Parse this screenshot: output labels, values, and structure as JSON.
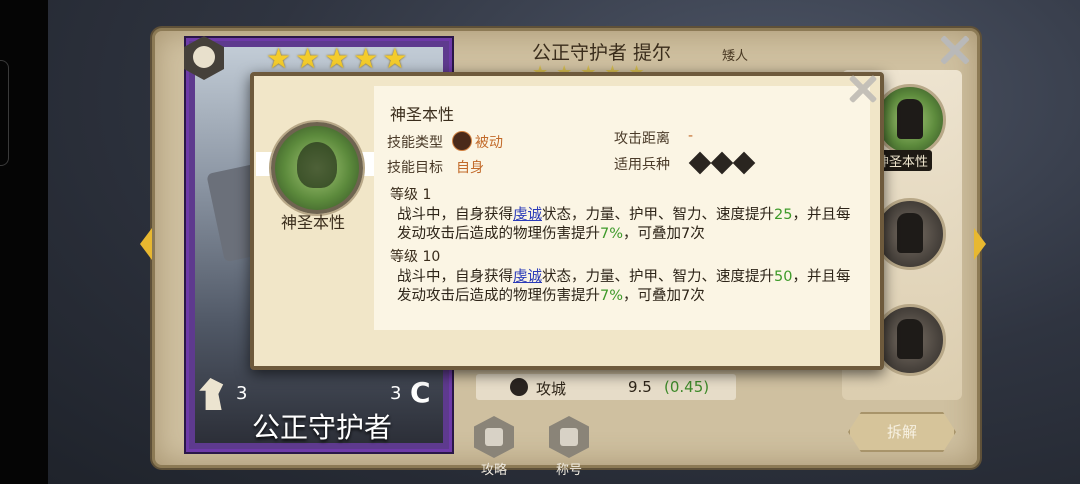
{
  "hero": {
    "title": "公正守护者 提尔",
    "race": "矮人",
    "card_name": "公正守护者",
    "star_count": 5,
    "left_count": "3",
    "right_count": "3"
  },
  "stats": [
    {
      "label": "攻城",
      "value": "9.5",
      "bonus": "(0.45)"
    }
  ],
  "side": {
    "active_skill_label": "神圣本性",
    "disassemble_label": "拆解"
  },
  "bottom": {
    "guide_label": "攻略",
    "title_label": "称号"
  },
  "skill_popup": {
    "emblem_name": "神圣本性",
    "name": "神圣本性",
    "type_label": "技能类型",
    "type_value": "被动",
    "range_label": "攻击距离",
    "range_value": "-",
    "target_label": "技能目标",
    "target_value": "自身",
    "troop_label": "适用兵种",
    "levels": [
      {
        "label": "等级 1",
        "d1": "战斗中，自身获得",
        "link": "虔诚",
        "d2": "状态，力量、护甲、智力、速度提升",
        "n1": "25",
        "d3": "，并且每",
        "d4": "发动攻击后造成的物理伤害提升",
        "n2": "7%",
        "d5": "，可叠加7次"
      },
      {
        "label": "等级 10",
        "d1": "战斗中，自身获得",
        "link": "虔诚",
        "d2": "状态，力量、护甲、智力、速度提升",
        "n1": "50",
        "d3": "，并且每",
        "d4": "发动攻击后造成的物理伤害提升",
        "n2": "7%",
        "d5": "，可叠加7次"
      }
    ]
  },
  "colors": {
    "panel": "#cfc0a0",
    "popup": "#f1e6c8",
    "highlight_number": "#3e9a2a",
    "link": "#2a3ab8",
    "value_orange": "#c26a2a",
    "star": "#f4cc2c"
  }
}
